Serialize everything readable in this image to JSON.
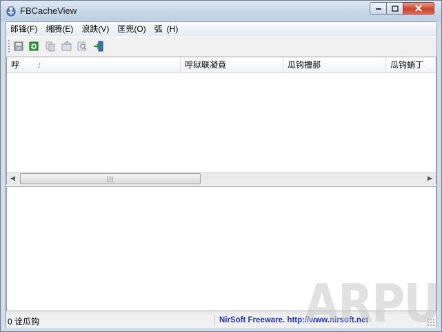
{
  "window": {
    "title": "FBCacheView",
    "app_icon": "fbcacheview-app-icon"
  },
  "menu": [
    {
      "label": "郎锋(F)"
    },
    {
      "label": "缃腾(E)"
    },
    {
      "label": "浪跌(V)"
    },
    {
      "label": "匡兜(O)"
    },
    {
      "label": "弧"
    },
    {
      "label": "(H)"
    }
  ],
  "toolbar": {
    "buttons": [
      {
        "icon": "save-icon"
      },
      {
        "icon": "refresh-icon"
      },
      {
        "icon": "copy-icon"
      },
      {
        "icon": "properties-icon"
      },
      {
        "icon": "find-icon"
      },
      {
        "icon": "exit-icon"
      }
    ]
  },
  "table": {
    "columns": [
      {
        "label": "呼"
      },
      {
        "label": "呼狱联凝竟"
      },
      {
        "label": "瓜钩擅郝"
      },
      {
        "label": "瓜钩蛸丁"
      }
    ],
    "sort_indicator": "/",
    "rows": []
  },
  "status": {
    "count": "0 诠瓜钩",
    "link": "NirSoft Freeware.  http://www.nirsoft.net"
  },
  "watermark": {
    "text": "ARPUN"
  },
  "colors": {
    "link": "#2034b8",
    "close_button": "#c9452c",
    "window_frame": "#cfdcea"
  }
}
